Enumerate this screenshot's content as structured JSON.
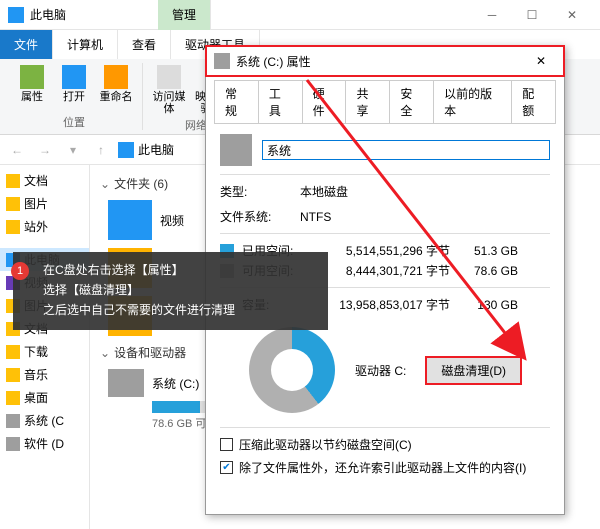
{
  "window": {
    "title": "此电脑",
    "manage_tab": "管理"
  },
  "tabs": {
    "file": "文件",
    "computer": "计算机",
    "view": "查看",
    "drive_tools": "驱动器工具"
  },
  "ribbon": {
    "properties": "属性",
    "open": "打开",
    "rename": "重命名",
    "access_media": "访问媒体",
    "map_network": "映射网络\n驱动器",
    "group_location": "位置",
    "group_network": "网络"
  },
  "breadcrumb": {
    "this_pc": "此电脑"
  },
  "tree": {
    "docs": "文档",
    "pics": "图片",
    "sites": "站外",
    "this_pc": "此电脑",
    "videos": "视频",
    "pics2": "图片",
    "docs2": "文档",
    "downloads": "下载",
    "music": "音乐",
    "desktop": "桌面",
    "sys_c": "系统 (C",
    "soft_d": "软件 (D"
  },
  "content": {
    "folders_header": "文件夹 (6)",
    "video_item": "视频",
    "drives_header": "设备和驱动器",
    "c_name": "系统 (C:)",
    "c_free": "78.6 GB 可"
  },
  "props": {
    "title": "系统 (C:) 属性",
    "tabs": {
      "general": "常规",
      "tools": "工具",
      "hardware": "硬件",
      "sharing": "共享",
      "security": "安全",
      "prev": "以前的版本",
      "quota": "配额"
    },
    "name_value": "系统",
    "type_label": "类型:",
    "type_value": "本地磁盘",
    "fs_label": "文件系统:",
    "fs_value": "NTFS",
    "used_label": "已用空间:",
    "used_bytes": "5,514,551,296 字节",
    "used_gb": "51.3 GB",
    "free_label": "可用空间:",
    "free_bytes": "8,444,301,721 字节",
    "free_gb": "78.6 GB",
    "cap_label": "容量:",
    "cap_bytes": "13,958,853,017 字节",
    "cap_gb": "130 GB",
    "drive_c": "驱动器 C:",
    "cleanup_btn": "磁盘清理(D)",
    "compress": "压缩此驱动器以节约磁盘空间(C)",
    "index": "除了文件属性外，还允许索引此驱动器上文件的内容(I)"
  },
  "tutorial": {
    "num": "1",
    "line1": "在C盘处右击选择【属性】",
    "line2": "选择【磁盘清理】",
    "line3": "之后选中自己不需要的文件进行清理"
  }
}
